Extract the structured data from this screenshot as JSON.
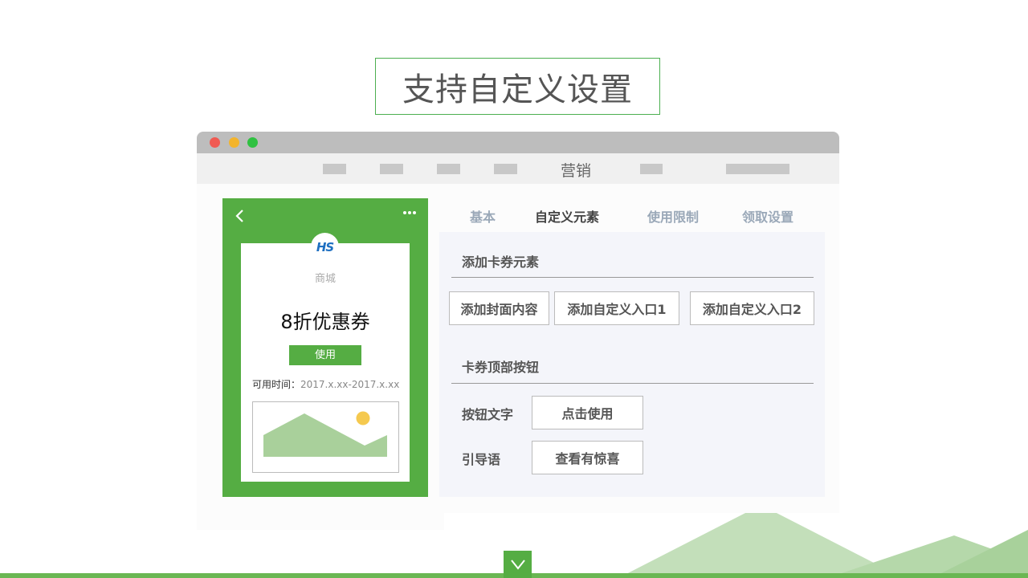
{
  "slide": {
    "title": "支持自定义设置"
  },
  "window": {
    "nav": {
      "label": "营销"
    }
  },
  "phone": {
    "logo_text": "HS",
    "shop_name": "商城",
    "coupon_name": "8折优惠券",
    "use_label": "使用",
    "valid_label": "可用时间：",
    "valid_value": "2017.x.xx-2017.x.xx"
  },
  "tabs": [
    {
      "label": "基本"
    },
    {
      "label": "自定义元素"
    },
    {
      "label": "使用限制"
    },
    {
      "label": "领取设置"
    }
  ],
  "active_tab": "自定义元素",
  "panel": {
    "section1_title": "添加卡券元素",
    "buttons": [
      {
        "label": "添加封面内容"
      },
      {
        "label": "添加自定义入口1"
      },
      {
        "label": "添加自定义入口2"
      }
    ],
    "section2_title": "卡券顶部按钮",
    "button_text_label": "按钮文字",
    "button_text_value": "点击使用",
    "guide_label": "引导语",
    "guide_value": "查看有惊喜"
  },
  "colors": {
    "accent": "#55ad43",
    "title_border": "#4caf50",
    "tab_inactive": "#9aa8b8",
    "panel_bg": "#f4f5fa"
  },
  "icons": {
    "back": "chevron-left-icon",
    "more": "more-dots-icon",
    "down": "chevron-down-icon"
  }
}
